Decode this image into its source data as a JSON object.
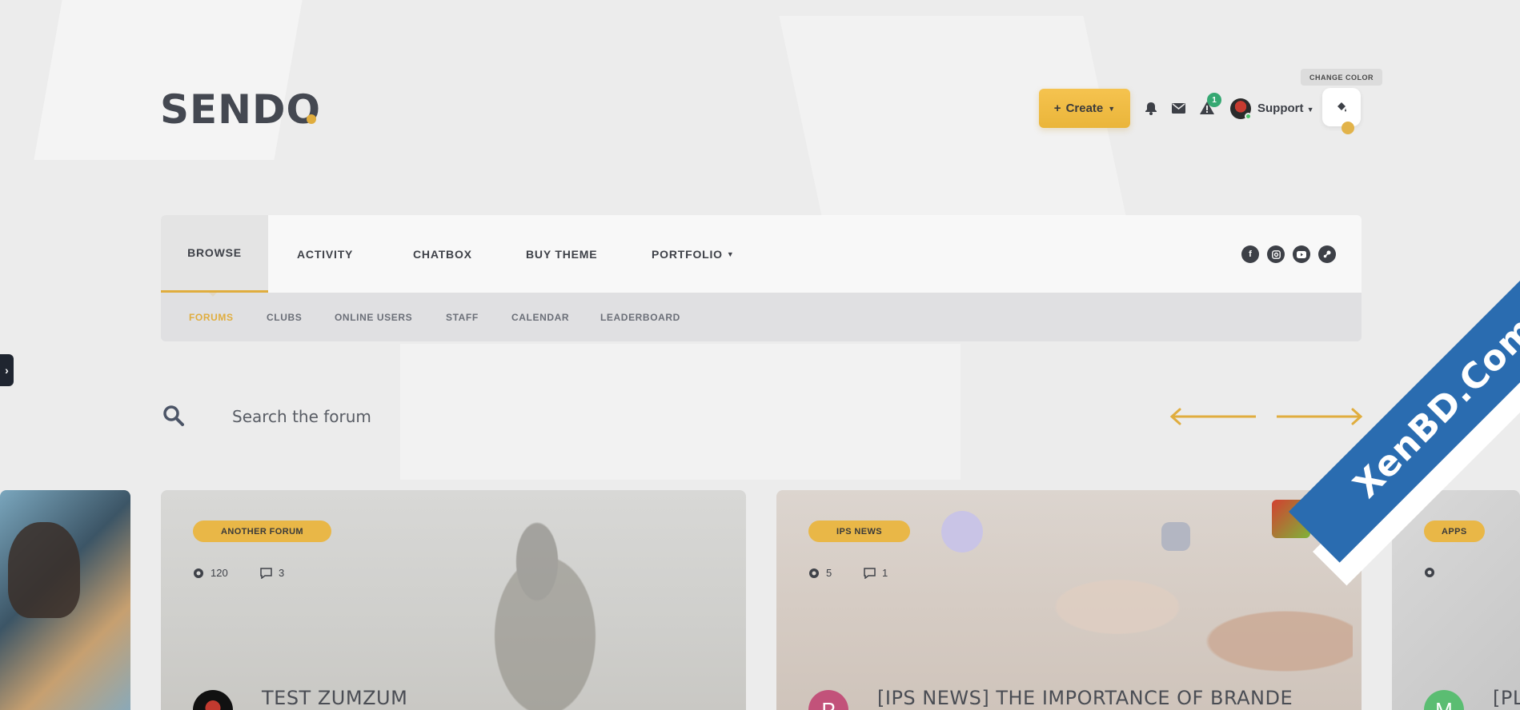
{
  "header": {
    "logo_text": "SENDO",
    "create_label": "Create",
    "notifications_badge": "1",
    "user_name": "Support",
    "change_color_tooltip": "CHANGE COLOR",
    "accent_color": "#e0ad3e"
  },
  "nav": {
    "items": [
      {
        "label": "BROWSE"
      },
      {
        "label": "ACTIVITY"
      },
      {
        "label": "CHATBOX"
      },
      {
        "label": "BUY THEME"
      },
      {
        "label": "PORTFOLIO"
      }
    ],
    "social": [
      "facebook-icon",
      "instagram-icon",
      "youtube-icon",
      "steam-icon"
    ]
  },
  "subnav": {
    "items": [
      {
        "label": "FORUMS"
      },
      {
        "label": "CLUBS"
      },
      {
        "label": "ONLINE USERS"
      },
      {
        "label": "STAFF"
      },
      {
        "label": "CALENDAR"
      },
      {
        "label": "LEADERBOARD"
      }
    ]
  },
  "search": {
    "placeholder": "Search the forum"
  },
  "cards": [
    {
      "category": "ANOTHER FORUM",
      "views": "120",
      "comments": "3",
      "title": "TEST ZUMZUM"
    },
    {
      "category": "IPS NEWS",
      "views": "5",
      "comments": "1",
      "title": "[IPS NEWS] THE IMPORTANCE OF BRANDE",
      "avatar_letter": "P"
    },
    {
      "category": "APPS",
      "title": "[PL",
      "avatar_letter": "M"
    }
  ],
  "watermark": "XenBD.Com"
}
